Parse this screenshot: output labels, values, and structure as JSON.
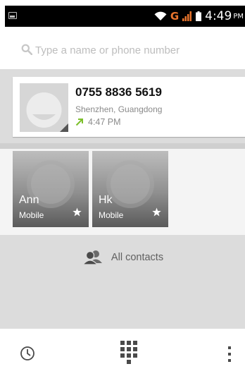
{
  "status_bar": {
    "network_type": "G",
    "time": "4:49",
    "ampm": "PM"
  },
  "search": {
    "placeholder": "Type a name or phone number",
    "value": ""
  },
  "recent_call": {
    "number": "0755 8836 5619",
    "location": "Shenzhen, Guangdong",
    "time": "4:47 PM",
    "call_type_icon": "outgoing-call-arrow-icon",
    "call_type_color": "#7cbf2a"
  },
  "favorites": [
    {
      "name": "Ann",
      "type": "Mobile"
    },
    {
      "name": "Hk",
      "type": "Mobile"
    }
  ],
  "all_contacts": {
    "label": "All contacts",
    "icon": "contacts-icon"
  },
  "bottom_bar": {
    "icons": [
      "recent-clock-icon",
      "dialpad-icon",
      "overflow-menu-icon"
    ]
  },
  "colors": {
    "status_bar_bg": "#000000",
    "section_bg": "#dcdcdc",
    "network_accent": "#e8742c",
    "signal_accent": "#e8742c"
  }
}
